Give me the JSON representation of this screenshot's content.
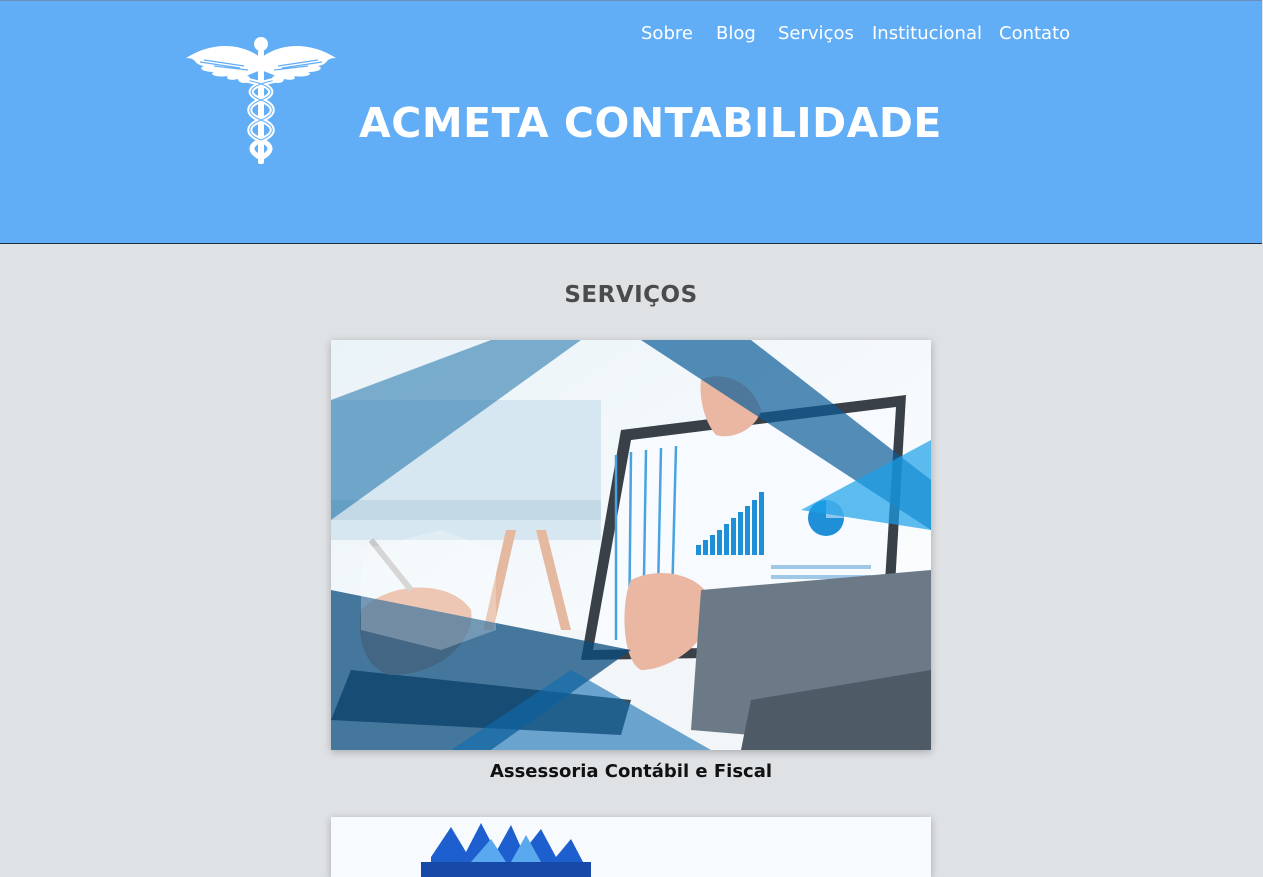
{
  "header": {
    "site_title": "ACMETA CONTABILIDADE",
    "background": "#61aef7",
    "logo_icon": "caduceus-icon"
  },
  "nav": {
    "items": [
      {
        "label": "Sobre"
      },
      {
        "label": "Blog"
      },
      {
        "label": "Serviços"
      },
      {
        "label": "Institucional"
      },
      {
        "label": "Contato"
      }
    ]
  },
  "main": {
    "section_title": "SERVIÇOS",
    "services": [
      {
        "caption": "Assessoria Contábil e Fiscal",
        "image": "business-charts-photo"
      },
      {
        "image": "blue-flower-photo"
      }
    ]
  }
}
